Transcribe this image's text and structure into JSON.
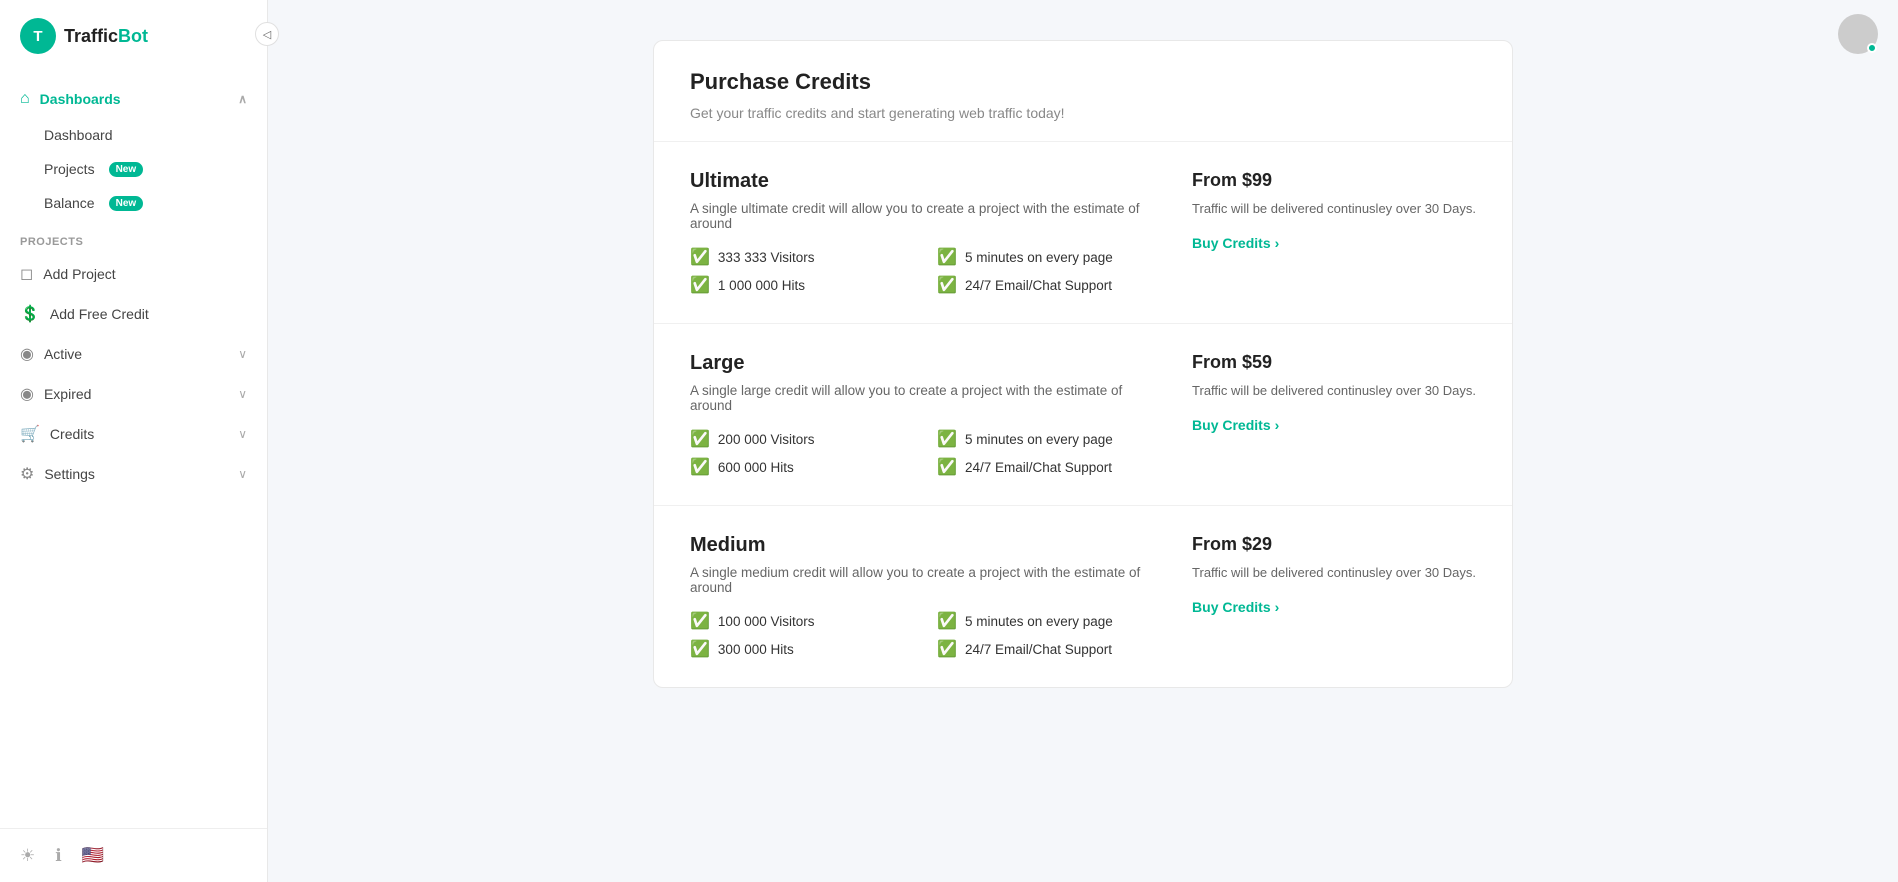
{
  "app": {
    "name": "TrafficBot",
    "logo_letter": "T"
  },
  "sidebar": {
    "collapse_icon": "◁",
    "sections": {
      "dashboards_label": "Dashboards",
      "dashboards_items": [
        {
          "id": "dashboard",
          "label": "Dashboard",
          "badge": null
        },
        {
          "id": "projects",
          "label": "Projects",
          "badge": "New"
        },
        {
          "id": "balance",
          "label": "Balance",
          "badge": "New"
        }
      ],
      "projects_section_label": "PROJECTS",
      "projects_items": [
        {
          "id": "add-project",
          "label": "Add Project",
          "icon": "📄",
          "has_chevron": false
        },
        {
          "id": "add-free-credit",
          "label": "Add Free Credit",
          "icon": "💲",
          "has_chevron": false
        },
        {
          "id": "active",
          "label": "Active",
          "icon": "▶",
          "has_chevron": true
        },
        {
          "id": "expired",
          "label": "Expired",
          "icon": "⏺",
          "has_chevron": true
        },
        {
          "id": "credits",
          "label": "Credits",
          "icon": "🛒",
          "has_chevron": true
        },
        {
          "id": "settings",
          "label": "Settings",
          "icon": "⚙",
          "has_chevron": true
        }
      ]
    },
    "footer": {
      "settings_icon": "☀",
      "info_icon": "ℹ",
      "flag_icon": "🇺🇸"
    }
  },
  "page": {
    "title": "Purchase Credits",
    "subtitle": "Get your traffic credits and start generating web traffic today!",
    "plans": [
      {
        "id": "ultimate",
        "name": "Ultimate",
        "description": "A single ultimate credit will allow you to create a project with the estimate of around",
        "features": [
          {
            "label": "333 333 Visitors"
          },
          {
            "label": "5 minutes on every page"
          },
          {
            "label": "1 000 000 Hits"
          },
          {
            "label": "24/7 Email/Chat Support"
          }
        ],
        "price": "From $99",
        "delivery": "Traffic will be delivered continusley over 30 Days.",
        "buy_label": "Buy Credits",
        "buy_arrow": "›"
      },
      {
        "id": "large",
        "name": "Large",
        "description": "A single large credit will allow you to create a project with the estimate of around",
        "features": [
          {
            "label": "200 000 Visitors"
          },
          {
            "label": "5 minutes on every page"
          },
          {
            "label": "600 000 Hits"
          },
          {
            "label": "24/7 Email/Chat Support"
          }
        ],
        "price": "From $59",
        "delivery": "Traffic will be delivered continusley over 30 Days.",
        "buy_label": "Buy Credits",
        "buy_arrow": "›"
      },
      {
        "id": "medium",
        "name": "Medium",
        "description": "A single medium credit will allow you to create a project with the estimate of around",
        "features": [
          {
            "label": "100 000 Visitors"
          },
          {
            "label": "5 minutes on every page"
          },
          {
            "label": "300 000 Hits"
          },
          {
            "label": "24/7 Email/Chat Support"
          }
        ],
        "price": "From $29",
        "delivery": "Traffic will be delivered continusley over 30 Days.",
        "buy_label": "Buy Credits",
        "buy_arrow": "›"
      }
    ]
  }
}
